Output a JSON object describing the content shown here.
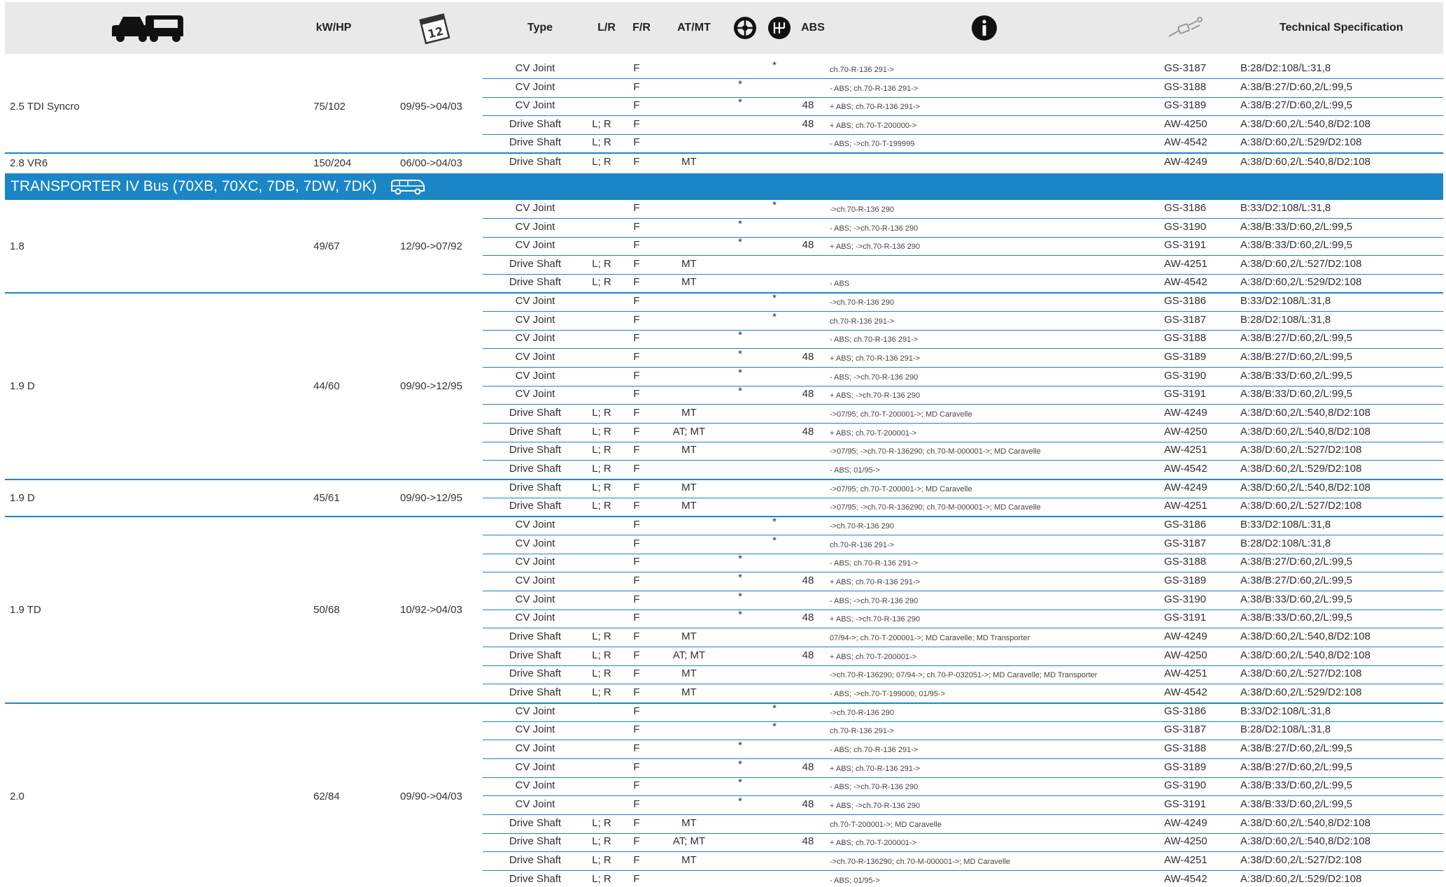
{
  "header": {
    "kw_hp": "kW/HP",
    "calendar_label": "12",
    "type": "Type",
    "lr": "L/R",
    "fr": "F/R",
    "atmt": "AT/MT",
    "abs": "ABS",
    "tech": "Technical Specification"
  },
  "colors": {
    "accent": "#1a86c8",
    "header_bg": "#e9e9e9"
  },
  "section": {
    "title": "TRANSPORTER IV Bus (70XB, 70XC, 7DB, 7DW, 7DK)",
    "icon": "minibus-icon"
  },
  "groups": [
    {
      "engine": "2.5 TDI Syncro",
      "kw": "75/102",
      "date": "09/95->04/03"
    },
    {
      "engine": "2.8 VR6",
      "kw": "150/204",
      "date": "06/00->04/03"
    },
    {
      "engine": "1.8",
      "kw": "49/67",
      "date": "12/90->07/92"
    },
    {
      "engine": "1.9 D",
      "kw": "44/60",
      "date": "09/90->12/95"
    },
    {
      "engine": "1.9 D",
      "kw": "45/61",
      "date": "09/90->12/95"
    },
    {
      "engine": "1.9 TD",
      "kw": "50/68",
      "date": "10/92->04/03"
    },
    {
      "engine": "2.0",
      "kw": "62/84",
      "date": "09/90->04/03"
    }
  ],
  "rows": [
    {
      "type": "CV Joint",
      "lr": "",
      "fr": "F",
      "at": "",
      "w": "",
      "g": "*",
      "abs": "",
      "info": "ch.70-R-136 291->",
      "code": "GS-3187",
      "spec": "B:28/D2:108/L:31,8"
    },
    {
      "type": "CV Joint",
      "lr": "",
      "fr": "F",
      "at": "",
      "w": "*",
      "g": "",
      "abs": "",
      "info": "- ABS; ch.70-R-136 291->",
      "code": "GS-3188",
      "spec": "A:38/B:27/D:60,2/L:99,5"
    },
    {
      "type": "CV Joint",
      "lr": "",
      "fr": "F",
      "at": "",
      "w": "*",
      "g": "",
      "abs": "48",
      "info": "+ ABS; ch.70-R-136 291->",
      "code": "GS-3189",
      "spec": "A:38/B:27/D:60,2/L:99,5"
    },
    {
      "type": "Drive Shaft",
      "lr": "L; R",
      "fr": "F",
      "at": "",
      "w": "",
      "g": "",
      "abs": "48",
      "info": "+ ABS; ch.70-T-200000->",
      "code": "AW-4250",
      "spec": "A:38/D:60,2/L:540,8/D2:108"
    },
    {
      "type": "Drive Shaft",
      "lr": "L; R",
      "fr": "F",
      "at": "",
      "w": "",
      "g": "",
      "abs": "",
      "info": "- ABS; ->ch.70-T-199999",
      "code": "AW-4542",
      "spec": "A:38/D:60,2/L:529/D2:108"
    },
    {
      "type": "Drive Shaft",
      "lr": "L; R",
      "fr": "F",
      "at": "MT",
      "w": "",
      "g": "",
      "abs": "",
      "info": "",
      "code": "AW-4249",
      "spec": "A:38/D:60,2/L:540,8/D2:108"
    },
    {
      "type": "CV Joint",
      "lr": "",
      "fr": "F",
      "at": "",
      "w": "",
      "g": "*",
      "abs": "",
      "info": "->ch.70-R-136 290",
      "code": "GS-3186",
      "spec": "B:33/D2:108/L:31,8"
    },
    {
      "type": "CV Joint",
      "lr": "",
      "fr": "F",
      "at": "",
      "w": "*",
      "g": "",
      "abs": "",
      "info": "- ABS; ->ch.70-R-136 290",
      "code": "GS-3190",
      "spec": "A:38/B:33/D:60,2/L:99,5"
    },
    {
      "type": "CV Joint",
      "lr": "",
      "fr": "F",
      "at": "",
      "w": "*",
      "g": "",
      "abs": "48",
      "info": "+ ABS; ->ch.70-R-136 290",
      "code": "GS-3191",
      "spec": "A:38/B:33/D:60,2/L:99,5"
    },
    {
      "type": "Drive Shaft",
      "lr": "L; R",
      "fr": "F",
      "at": "MT",
      "w": "",
      "g": "",
      "abs": "",
      "info": "",
      "code": "AW-4251",
      "spec": "A:38/D:60,2/L:527/D2:108"
    },
    {
      "type": "Drive Shaft",
      "lr": "L; R",
      "fr": "F",
      "at": "MT",
      "w": "",
      "g": "",
      "abs": "",
      "info": "- ABS",
      "code": "AW-4542",
      "spec": "A:38/D:60,2/L:529/D2:108"
    },
    {
      "type": "CV Joint",
      "lr": "",
      "fr": "F",
      "at": "",
      "w": "",
      "g": "*",
      "abs": "",
      "info": "->ch.70-R-136 290",
      "code": "GS-3186",
      "spec": "B:33/D2:108/L:31,8"
    },
    {
      "type": "CV Joint",
      "lr": "",
      "fr": "F",
      "at": "",
      "w": "",
      "g": "*",
      "abs": "",
      "info": "ch.70-R-136 291->",
      "code": "GS-3187",
      "spec": "B:28/D2:108/L:31,8"
    },
    {
      "type": "CV Joint",
      "lr": "",
      "fr": "F",
      "at": "",
      "w": "*",
      "g": "",
      "abs": "",
      "info": "- ABS; ch.70-R-136 291->",
      "code": "GS-3188",
      "spec": "A:38/B:27/D:60,2/L:99,5"
    },
    {
      "type": "CV Joint",
      "lr": "",
      "fr": "F",
      "at": "",
      "w": "*",
      "g": "",
      "abs": "48",
      "info": "+ ABS; ch.70-R-136 291->",
      "code": "GS-3189",
      "spec": "A:38/B:27/D:60,2/L:99,5"
    },
    {
      "type": "CV Joint",
      "lr": "",
      "fr": "F",
      "at": "",
      "w": "*",
      "g": "",
      "abs": "",
      "info": "- ABS; ->ch.70-R-136 290",
      "code": "GS-3190",
      "spec": "A:38/B:33/D:60,2/L:99,5"
    },
    {
      "type": "CV Joint",
      "lr": "",
      "fr": "F",
      "at": "",
      "w": "*",
      "g": "",
      "abs": "48",
      "info": "+ ABS; ->ch.70-R-136 290",
      "code": "GS-3191",
      "spec": "A:38/B:33/D:60,2/L:99,5"
    },
    {
      "type": "Drive Shaft",
      "lr": "L; R",
      "fr": "F",
      "at": "MT",
      "w": "",
      "g": "",
      "abs": "",
      "info": "->07/95; ch.70-T-200001->; MD Caravelle",
      "code": "AW-4249",
      "spec": "A:38/D:60,2/L:540,8/D2:108"
    },
    {
      "type": "Drive Shaft",
      "lr": "L; R",
      "fr": "F",
      "at": "AT; MT",
      "w": "",
      "g": "",
      "abs": "48",
      "info": "+ ABS; ch.70-T-200001->",
      "code": "AW-4250",
      "spec": "A:38/D:60,2/L:540,8/D2:108"
    },
    {
      "type": "Drive Shaft",
      "lr": "L; R",
      "fr": "F",
      "at": "MT",
      "w": "",
      "g": "",
      "abs": "",
      "info": "->07/95; ->ch.70-R-136290; ch.70-M-000001->; MD Caravelle",
      "code": "AW-4251",
      "spec": "A:38/D:60,2/L:527/D2:108"
    },
    {
      "type": "Drive Shaft",
      "lr": "L; R",
      "fr": "F",
      "at": "",
      "w": "",
      "g": "",
      "abs": "",
      "info": "- ABS; 01/95->",
      "code": "AW-4542",
      "spec": "A:38/D:60,2/L:529/D2:108"
    },
    {
      "type": "Drive Shaft",
      "lr": "L; R",
      "fr": "F",
      "at": "MT",
      "w": "",
      "g": "",
      "abs": "",
      "info": "->07/95; ch.70-T-200001->; MD Caravelle",
      "code": "AW-4249",
      "spec": "A:38/D:60,2/L:540,8/D2:108"
    },
    {
      "type": "Drive Shaft",
      "lr": "L; R",
      "fr": "F",
      "at": "MT",
      "w": "",
      "g": "",
      "abs": "",
      "info": "->07/95; ->ch.70-R-136290; ch.70-M-000001->; MD Caravelle",
      "code": "AW-4251",
      "spec": "A:38/D:60,2/L:527/D2:108"
    },
    {
      "type": "CV Joint",
      "lr": "",
      "fr": "F",
      "at": "",
      "w": "",
      "g": "*",
      "abs": "",
      "info": "->ch.70-R-136 290",
      "code": "GS-3186",
      "spec": "B:33/D2:108/L:31,8"
    },
    {
      "type": "CV Joint",
      "lr": "",
      "fr": "F",
      "at": "",
      "w": "",
      "g": "*",
      "abs": "",
      "info": "ch.70-R-136 291->",
      "code": "GS-3187",
      "spec": "B:28/D2:108/L:31,8"
    },
    {
      "type": "CV Joint",
      "lr": "",
      "fr": "F",
      "at": "",
      "w": "*",
      "g": "",
      "abs": "",
      "info": "- ABS; ch.70-R-136 291->",
      "code": "GS-3188",
      "spec": "A:38/B:27/D:60,2/L:99,5"
    },
    {
      "type": "CV Joint",
      "lr": "",
      "fr": "F",
      "at": "",
      "w": "*",
      "g": "",
      "abs": "48",
      "info": "+ ABS; ch.70-R-136 291->",
      "code": "GS-3189",
      "spec": "A:38/B:27/D:60,2/L:99,5"
    },
    {
      "type": "CV Joint",
      "lr": "",
      "fr": "F",
      "at": "",
      "w": "*",
      "g": "",
      "abs": "",
      "info": "- ABS; ->ch.70-R-136 290",
      "code": "GS-3190",
      "spec": "A:38/B:33/D:60,2/L:99,5"
    },
    {
      "type": "CV Joint",
      "lr": "",
      "fr": "F",
      "at": "",
      "w": "*",
      "g": "",
      "abs": "48",
      "info": "+ ABS; ->ch.70-R-136 290",
      "code": "GS-3191",
      "spec": "A:38/B:33/D:60,2/L:99,5"
    },
    {
      "type": "Drive Shaft",
      "lr": "L; R",
      "fr": "F",
      "at": "MT",
      "w": "",
      "g": "",
      "abs": "",
      "info": "07/94->; ch.70-T-200001->; MD Caravelle; MD Transporter",
      "code": "AW-4249",
      "spec": "A:38/D:60,2/L:540,8/D2:108"
    },
    {
      "type": "Drive Shaft",
      "lr": "L; R",
      "fr": "F",
      "at": "AT; MT",
      "w": "",
      "g": "",
      "abs": "48",
      "info": "+ ABS; ch.70-T-200001->",
      "code": "AW-4250",
      "spec": "A:38/D:60,2/L:540,8/D2:108"
    },
    {
      "type": "Drive Shaft",
      "lr": "L; R",
      "fr": "F",
      "at": "MT",
      "w": "",
      "g": "",
      "abs": "",
      "info": "->ch.70-R-136290; 07/94->; ch.70-P-032051->; MD Caravelle; MD Transporter",
      "code": "AW-4251",
      "spec": "A:38/D:60,2/L:527/D2:108"
    },
    {
      "type": "Drive Shaft",
      "lr": "L; R",
      "fr": "F",
      "at": "MT",
      "w": "",
      "g": "",
      "abs": "",
      "info": "- ABS; ->ch.70-T-199000; 01/95->",
      "code": "AW-4542",
      "spec": "A:38/D:60,2/L:529/D2:108"
    },
    {
      "type": "CV Joint",
      "lr": "",
      "fr": "F",
      "at": "",
      "w": "",
      "g": "*",
      "abs": "",
      "info": "->ch.70-R-136 290",
      "code": "GS-3186",
      "spec": "B:33/D2:108/L:31,8"
    },
    {
      "type": "CV Joint",
      "lr": "",
      "fr": "F",
      "at": "",
      "w": "",
      "g": "*",
      "abs": "",
      "info": "ch.70-R-136 291->",
      "code": "GS-3187",
      "spec": "B:28/D2:108/L:31,8"
    },
    {
      "type": "CV Joint",
      "lr": "",
      "fr": "F",
      "at": "",
      "w": "*",
      "g": "",
      "abs": "",
      "info": "- ABS; ch.70-R-136 291->",
      "code": "GS-3188",
      "spec": "A:38/B:27/D:60,2/L:99,5"
    },
    {
      "type": "CV Joint",
      "lr": "",
      "fr": "F",
      "at": "",
      "w": "*",
      "g": "",
      "abs": "48",
      "info": "+ ABS; ch.70-R-136 291->",
      "code": "GS-3189",
      "spec": "A:38/B:27/D:60,2/L:99,5"
    },
    {
      "type": "CV Joint",
      "lr": "",
      "fr": "F",
      "at": "",
      "w": "*",
      "g": "",
      "abs": "",
      "info": "- ABS; ->ch.70-R-136 290",
      "code": "GS-3190",
      "spec": "A:38/B:33/D:60,2/L:99,5"
    },
    {
      "type": "CV Joint",
      "lr": "",
      "fr": "F",
      "at": "",
      "w": "*",
      "g": "",
      "abs": "48",
      "info": "+ ABS; ->ch.70-R-136 290",
      "code": "GS-3191",
      "spec": "A:38/B:33/D:60,2/L:99,5"
    },
    {
      "type": "Drive Shaft",
      "lr": "L; R",
      "fr": "F",
      "at": "MT",
      "w": "",
      "g": "",
      "abs": "",
      "info": "ch.70-T-200001->; MD Caravelle",
      "code": "AW-4249",
      "spec": "A:38/D:60,2/L:540,8/D2:108"
    },
    {
      "type": "Drive Shaft",
      "lr": "L; R",
      "fr": "F",
      "at": "AT; MT",
      "w": "",
      "g": "",
      "abs": "48",
      "info": "+ ABS; ch.70-T-200001->",
      "code": "AW-4250",
      "spec": "A:38/D:60,2/L:540,8/D2:108"
    },
    {
      "type": "Drive Shaft",
      "lr": "L; R",
      "fr": "F",
      "at": "MT",
      "w": "",
      "g": "",
      "abs": "",
      "info": "->ch.70-R-136290; ch.70-M-000001->; MD Caravelle",
      "code": "AW-4251",
      "spec": "A:38/D:60,2/L:527/D2:108"
    },
    {
      "type": "Drive Shaft",
      "lr": "L; R",
      "fr": "F",
      "at": "",
      "w": "",
      "g": "",
      "abs": "",
      "info": "- ABS; 01/95->",
      "code": "AW-4542",
      "spec": "A:38/D:60,2/L:529/D2:108"
    }
  ]
}
